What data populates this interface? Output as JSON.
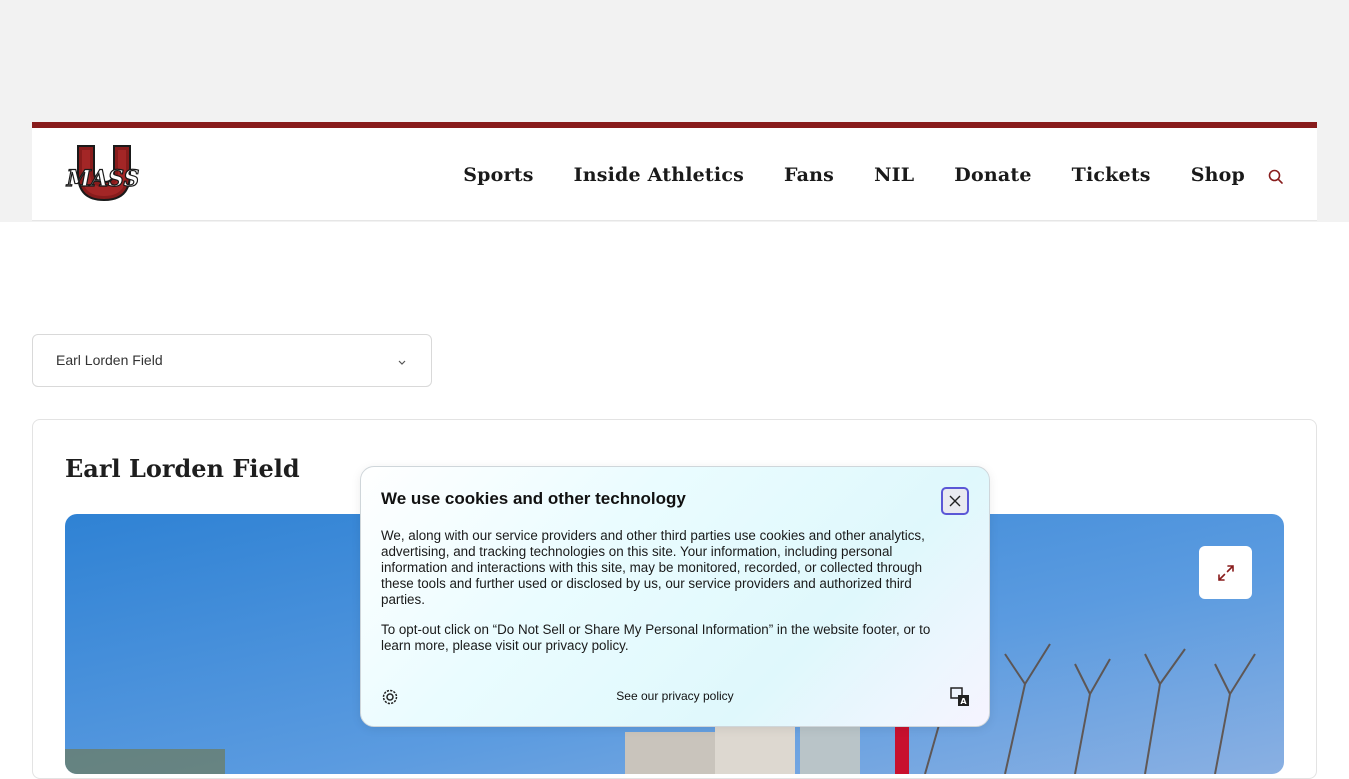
{
  "header": {
    "logo_alt": "UMass",
    "logo_text": "MASS",
    "nav": [
      "Sports",
      "Inside Athletics",
      "Fans",
      "NIL",
      "Donate",
      "Tickets",
      "Shop"
    ],
    "search_icon": "search-icon"
  },
  "venue_select": {
    "value": "Earl Lorden Field",
    "icon": "chevron-down-icon"
  },
  "card": {
    "title": "Earl Lorden Field",
    "expand_icon": "expand-icon"
  },
  "cookie_banner": {
    "title": "We use cookies and other technology",
    "paragraph1": "We, along with our service providers and other third parties use cookies and other analytics, advertising, and tracking technologies on this site. Your information, including personal information and interactions with this site, may be monitored, recorded, or collected through these tools and further used or disclosed by us, our service providers and authorized third parties.",
    "paragraph2": "To opt-out click on “Do Not Sell or Share My Personal Information” in the website footer, or to learn more, please visit our privacy policy.",
    "privacy_link": "See our privacy policy",
    "settings_icon": "gear-icon",
    "translate_icon": "translate-icon",
    "close_icon": "close-icon"
  },
  "colors": {
    "brand": "#881c1c",
    "focus": "#5b57d6"
  }
}
